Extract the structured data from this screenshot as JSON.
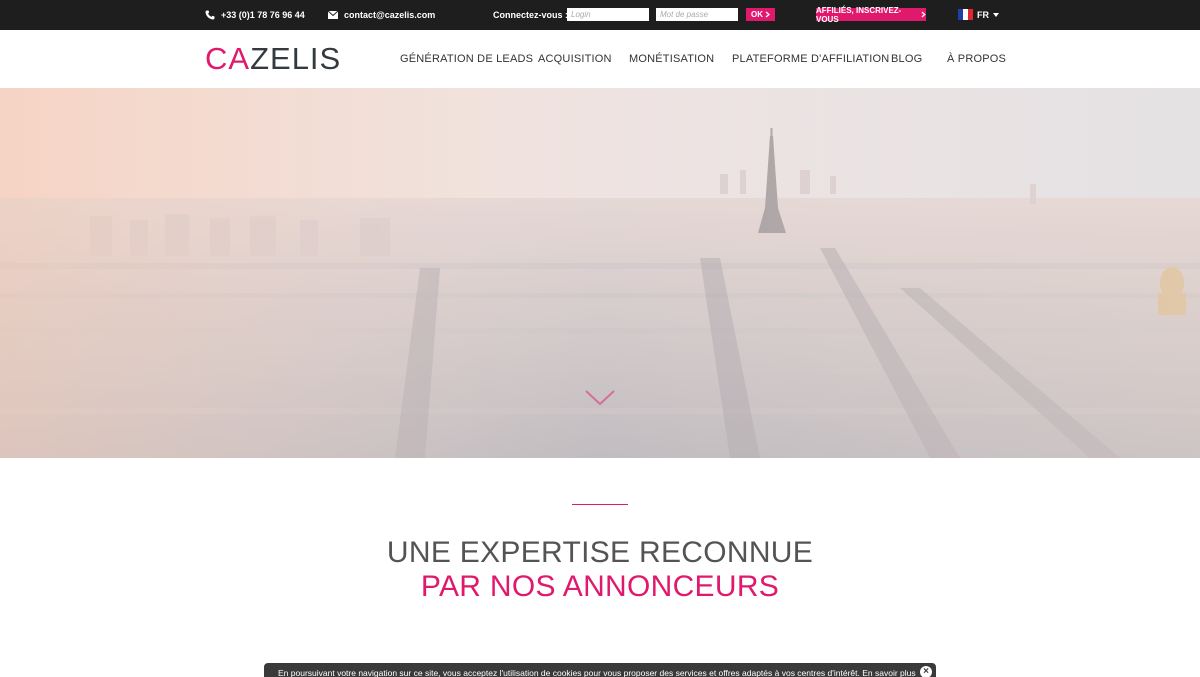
{
  "topbar": {
    "phone": "+33 (0)1 78 76 96 44",
    "email": "contact@cazelis.com",
    "login_label": "Connectez-vous :",
    "login_placeholder": "Login",
    "password_placeholder": "Mot de passe",
    "ok_label": "OK",
    "affiliate_label": "AFFILIÉS, INSCRIVEZ-VOUS",
    "language": "FR",
    "icons": [
      "phone-icon",
      "envelope-icon",
      "chevron-right-icon",
      "french-flag-icon",
      "caret-down-icon"
    ]
  },
  "header": {
    "logo_part1": "CA",
    "logo_part2": "ZELIS",
    "nav": [
      "GÉNÉRATION DE LEADS",
      "ACQUISITION",
      "MONÉTISATION",
      "PLATEFORME D'AFFILIATION",
      "BLOG",
      "À PROPOS"
    ]
  },
  "hero": {
    "scroll_icon": "chevron-down-icon"
  },
  "section": {
    "headline_line1": "UNE EXPERTISE RECONNUE",
    "headline_line2": "PAR NOS ANNONCEURS"
  },
  "cookie": {
    "text": "En poursuivant votre navigation sur ce site, vous acceptez l'utilisation de cookies pour vous proposer des services et offres adaptés à vos centres d'intérêt.",
    "link": "En savoir plus",
    "close": "×"
  },
  "colors": {
    "accent": "#e0196d",
    "topbar": "#1e1e1e",
    "headline_gray": "#545454"
  }
}
